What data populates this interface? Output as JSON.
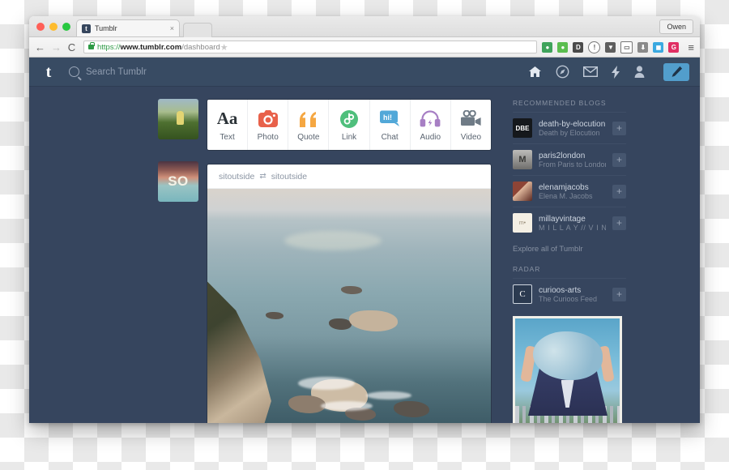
{
  "browser": {
    "tab_title": "Tumblr",
    "tab_favicon_letter": "t",
    "tab_close": "×",
    "profile_label": "Owen",
    "back_icon": "←",
    "forward_icon": "→",
    "reload_icon": "C",
    "star_icon": "★",
    "menu_icon": "≡",
    "url": {
      "scheme": "https://",
      "host": "www.tumblr.com",
      "path": "/dashboard"
    },
    "extensions": [
      {
        "name": "hangouts-extension-icon",
        "glyph": "●",
        "color": "#3fa35b"
      },
      {
        "name": "thumbs-up-extension-icon",
        "glyph": "●",
        "color": "#5bbd4f"
      },
      {
        "name": "downloads-extension-icon",
        "glyph": "D",
        "color": "#4a4a4a"
      },
      {
        "name": "info-extension-icon",
        "glyph": "ⓘ",
        "color": "#6b6b6b"
      },
      {
        "name": "shield-extension-icon",
        "glyph": "▼",
        "color": "#5e5e5e"
      },
      {
        "name": "window-extension-icon",
        "glyph": "▭",
        "color": "#6b6b6b"
      },
      {
        "name": "save-extension-icon",
        "glyph": "⬇",
        "color": "#7a7a7a"
      },
      {
        "name": "camera-extension-icon",
        "glyph": "■",
        "color": "#3ba9e0"
      },
      {
        "name": "google-extension-icon",
        "glyph": "G",
        "color": "#e02f63"
      }
    ]
  },
  "topnav": {
    "logo_letter": "t",
    "search_placeholder": "Search Tumblr",
    "icons": [
      {
        "name": "home-icon",
        "label": "Home"
      },
      {
        "name": "explore-compass-icon",
        "label": "Explore"
      },
      {
        "name": "messages-envelope-icon",
        "label": "Messages"
      },
      {
        "name": "activity-lightning-icon",
        "label": "Activity"
      },
      {
        "name": "account-person-icon",
        "label": "Account"
      }
    ],
    "compose_label": "Compose"
  },
  "rail": {
    "avatars": [
      {
        "name": "avatar-field-photo",
        "label": ""
      },
      {
        "name": "avatar-sunset-so",
        "label": "SO"
      }
    ]
  },
  "post_types": [
    {
      "name": "text",
      "label": "Text",
      "glyph": "Aa",
      "color": "#2c3338"
    },
    {
      "name": "photo",
      "label": "Photo",
      "color": "#e8614a"
    },
    {
      "name": "quote",
      "label": "Quote",
      "glyph": "“",
      "color": "#f5a742"
    },
    {
      "name": "link",
      "label": "Link",
      "color": "#4fbf7c"
    },
    {
      "name": "chat",
      "label": "Chat",
      "glyph": "hi!",
      "color": "#52a8d8"
    },
    {
      "name": "audio",
      "label": "Audio",
      "color": "#a77fc4"
    },
    {
      "name": "video",
      "label": "Video",
      "color": "#6f7b86"
    }
  ],
  "post": {
    "blog_name": "sitoutside",
    "source_name": "sitoutside",
    "reblog_icon": "⇄"
  },
  "sidebar": {
    "recommended_heading": "RECOMMENDED BLOGS",
    "recommended": [
      {
        "name": "death-by-elocution",
        "desc": "Death by Elocution",
        "avatar_text": "DBE",
        "avatar_bg": "#15181c",
        "avatar_fg": "#ffffff"
      },
      {
        "name": "paris2london",
        "desc": "From Paris to London",
        "avatar_text": "M",
        "avatar_bg": "#9b9a98",
        "avatar_fg": "#3a3a38"
      },
      {
        "name": "elenamjacobs",
        "desc": "Elena M. Jacobs",
        "avatar_text": "",
        "avatar_bg": "#7d3b30",
        "avatar_fg": "#e8c4ad"
      },
      {
        "name": "millayvintage",
        "desc": "M I L L A Y // V I N T",
        "avatar_text": "m•",
        "avatar_bg": "#f4efe4",
        "avatar_fg": "#9b8f7a"
      }
    ],
    "explore_link": "Explore all of Tumblr",
    "radar_heading": "RADAR",
    "radar": {
      "name": "curioos-arts",
      "desc": "The Curioos Feed",
      "avatar_text": "C",
      "avatar_bg": "#2b3a50",
      "avatar_fg": "#ffffff"
    },
    "follow_icon": "+"
  },
  "colors": {
    "dashboard_bg": "#36455e",
    "nav_bg": "#384b63",
    "accent_blue": "#529ecc"
  }
}
